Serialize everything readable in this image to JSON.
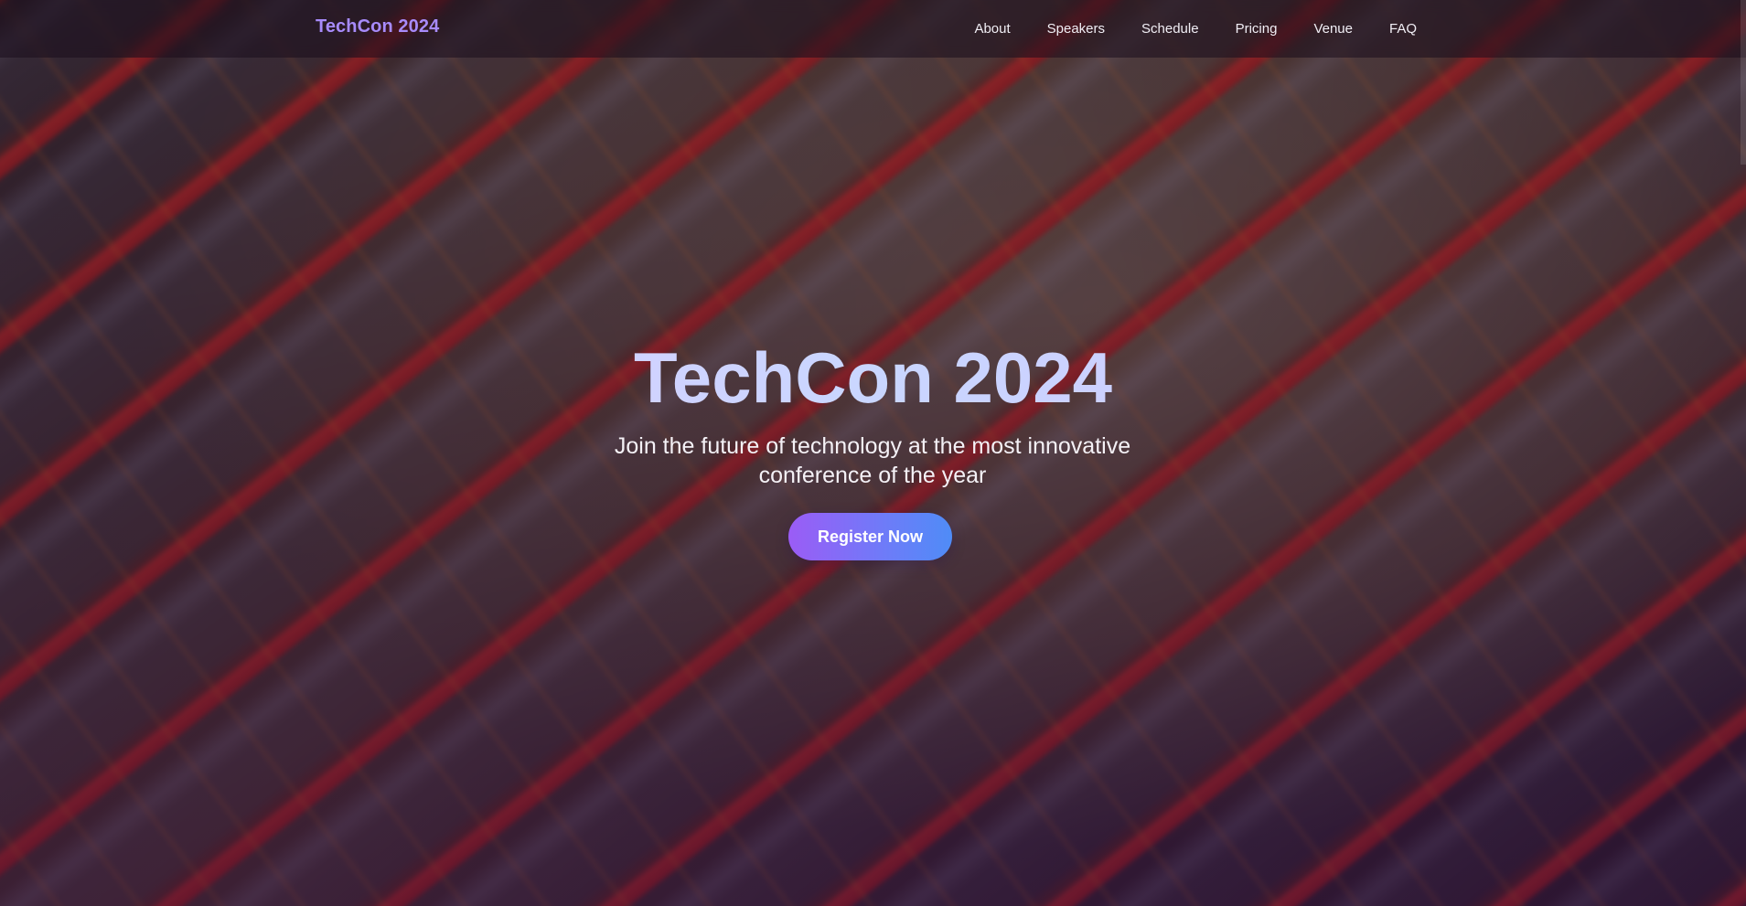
{
  "brand": {
    "name": "TechCon 2024",
    "color": "#a78bfa"
  },
  "nav": {
    "links": [
      {
        "label": "About"
      },
      {
        "label": "Speakers"
      },
      {
        "label": "Schedule"
      },
      {
        "label": "Pricing"
      },
      {
        "label": "Venue"
      },
      {
        "label": "FAQ"
      }
    ]
  },
  "hero": {
    "title": "TechCon 2024",
    "subtitle": "Join the future of technology at the most innovative conference of the year",
    "cta_label": "Register Now",
    "cta_gradient": [
      "#9b5cf6",
      "#4f8cf7"
    ]
  }
}
